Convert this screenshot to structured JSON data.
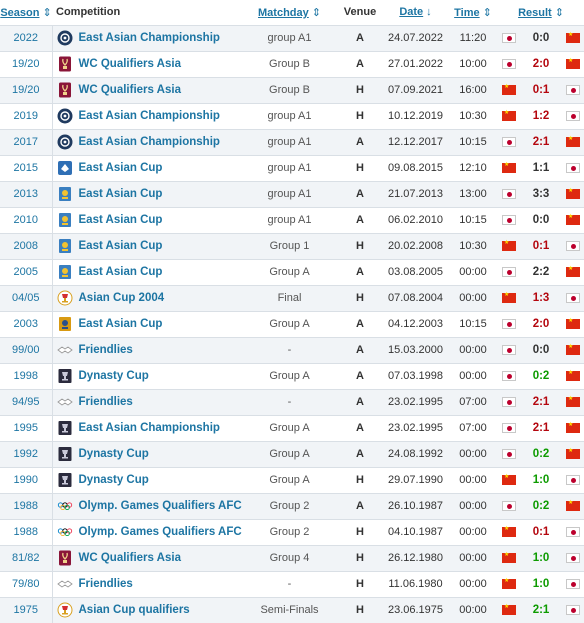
{
  "headers": {
    "season": "Season",
    "competition": "Competition",
    "matchday": "Matchday",
    "venue": "Venue",
    "date": "Date",
    "time": "Time",
    "result": "Result"
  },
  "sort_icons": {
    "season": "⇕",
    "matchday": "⇕",
    "date": "↓",
    "time": "⇕",
    "result": "⇕"
  },
  "colors": {
    "link": "#1d75a3",
    "loss": "#b4060e",
    "win": "#0d9b00",
    "draw": "#333333"
  },
  "rows": [
    {
      "season": "2022",
      "competition": "East Asian Championship",
      "logo": "eaff-logo",
      "matchday": "group A1",
      "venue": "A",
      "date": "24.07.2022",
      "time": "11:20",
      "home_flag": "jpn",
      "away_flag": "chn",
      "score": "0:0",
      "outcome": "draw"
    },
    {
      "season": "19/20",
      "competition": "WC Qualifiers Asia",
      "logo": "world-cup-logo",
      "matchday": "Group B",
      "venue": "A",
      "date": "27.01.2022",
      "time": "10:00",
      "home_flag": "jpn",
      "away_flag": "chn",
      "score": "2:0",
      "outcome": "loss"
    },
    {
      "season": "19/20",
      "competition": "WC Qualifiers Asia",
      "logo": "world-cup-logo",
      "matchday": "Group B",
      "venue": "H",
      "date": "07.09.2021",
      "time": "16:00",
      "home_flag": "chn",
      "away_flag": "jpn",
      "score": "0:1",
      "outcome": "loss"
    },
    {
      "season": "2019",
      "competition": "East Asian Championship",
      "logo": "eaff-logo",
      "matchday": "group A1",
      "venue": "H",
      "date": "10.12.2019",
      "time": "10:30",
      "home_flag": "chn",
      "away_flag": "jpn",
      "score": "1:2",
      "outcome": "loss"
    },
    {
      "season": "2017",
      "competition": "East Asian Championship",
      "logo": "eaff-logo",
      "matchday": "group A1",
      "venue": "A",
      "date": "12.12.2017",
      "time": "10:15",
      "home_flag": "jpn",
      "away_flag": "chn",
      "score": "2:1",
      "outcome": "loss"
    },
    {
      "season": "2015",
      "competition": "East Asian Cup",
      "logo": "eaff-logo-2015",
      "matchday": "group A1",
      "venue": "H",
      "date": "09.08.2015",
      "time": "12:10",
      "home_flag": "chn",
      "away_flag": "jpn",
      "score": "1:1",
      "outcome": "draw"
    },
    {
      "season": "2013",
      "competition": "East Asian Cup",
      "logo": "eaff-cup-logo",
      "matchday": "group A1",
      "venue": "A",
      "date": "21.07.2013",
      "time": "13:00",
      "home_flag": "jpn",
      "away_flag": "chn",
      "score": "3:3",
      "outcome": "draw"
    },
    {
      "season": "2010",
      "competition": "East Asian Cup",
      "logo": "eaff-cup-logo",
      "matchday": "group A1",
      "venue": "A",
      "date": "06.02.2010",
      "time": "10:15",
      "home_flag": "jpn",
      "away_flag": "chn",
      "score": "0:0",
      "outcome": "draw"
    },
    {
      "season": "2008",
      "competition": "East Asian Cup",
      "logo": "eaff-cup-logo",
      "matchday": "Group 1",
      "venue": "H",
      "date": "20.02.2008",
      "time": "10:30",
      "home_flag": "chn",
      "away_flag": "jpn",
      "score": "0:1",
      "outcome": "loss"
    },
    {
      "season": "2005",
      "competition": "East Asian Cup",
      "logo": "eaff-cup-logo",
      "matchday": "Group A",
      "venue": "A",
      "date": "03.08.2005",
      "time": "00:00",
      "home_flag": "jpn",
      "away_flag": "chn",
      "score": "2:2",
      "outcome": "draw"
    },
    {
      "season": "04/05",
      "competition": "Asian Cup 2004",
      "logo": "asian-cup-logo",
      "matchday": "Final",
      "venue": "H",
      "date": "07.08.2004",
      "time": "00:00",
      "home_flag": "chn",
      "away_flag": "jpn",
      "score": "1:3",
      "outcome": "loss"
    },
    {
      "season": "2003",
      "competition": "East Asian Cup",
      "logo": "eaff-cup-gold-logo",
      "matchday": "Group A",
      "venue": "A",
      "date": "04.12.2003",
      "time": "10:15",
      "home_flag": "jpn",
      "away_flag": "chn",
      "score": "2:0",
      "outcome": "loss"
    },
    {
      "season": "99/00",
      "competition": "Friendlies",
      "logo": "handshake-logo",
      "matchday": "-",
      "venue": "A",
      "date": "15.03.2000",
      "time": "00:00",
      "home_flag": "jpn",
      "away_flag": "chn",
      "score": "0:0",
      "outcome": "draw"
    },
    {
      "season": "1998",
      "competition": "Dynasty Cup",
      "logo": "dynasty-cup-logo",
      "matchday": "Group A",
      "venue": "A",
      "date": "07.03.1998",
      "time": "00:00",
      "home_flag": "jpn",
      "away_flag": "chn",
      "score": "0:2",
      "outcome": "win"
    },
    {
      "season": "94/95",
      "competition": "Friendlies",
      "logo": "handshake-logo",
      "matchday": "-",
      "venue": "A",
      "date": "23.02.1995",
      "time": "07:00",
      "home_flag": "jpn",
      "away_flag": "chn",
      "score": "2:1",
      "outcome": "loss"
    },
    {
      "season": "1995",
      "competition": "East Asian Championship",
      "logo": "dynasty-cup-logo",
      "matchday": "Group A",
      "venue": "A",
      "date": "23.02.1995",
      "time": "07:00",
      "home_flag": "jpn",
      "away_flag": "chn",
      "score": "2:1",
      "outcome": "loss"
    },
    {
      "season": "1992",
      "competition": "Dynasty Cup",
      "logo": "dynasty-cup-logo",
      "matchday": "Group A",
      "venue": "A",
      "date": "24.08.1992",
      "time": "00:00",
      "home_flag": "jpn",
      "away_flag": "chn",
      "score": "0:2",
      "outcome": "win"
    },
    {
      "season": "1990",
      "competition": "Dynasty Cup",
      "logo": "dynasty-cup-logo",
      "matchday": "Group A",
      "venue": "H",
      "date": "29.07.1990",
      "time": "00:00",
      "home_flag": "chn",
      "away_flag": "jpn",
      "score": "1:0",
      "outcome": "win"
    },
    {
      "season": "1988",
      "competition": "Olymp. Games Qualifiers AFC",
      "logo": "olympic-rings-logo",
      "matchday": "Group 2",
      "venue": "A",
      "date": "26.10.1987",
      "time": "00:00",
      "home_flag": "jpn",
      "away_flag": "chn",
      "score": "0:2",
      "outcome": "win"
    },
    {
      "season": "1988",
      "competition": "Olymp. Games Qualifiers AFC",
      "logo": "olympic-rings-logo",
      "matchday": "Group 2",
      "venue": "H",
      "date": "04.10.1987",
      "time": "00:00",
      "home_flag": "chn",
      "away_flag": "jpn",
      "score": "0:1",
      "outcome": "loss"
    },
    {
      "season": "81/82",
      "competition": "WC Qualifiers Asia",
      "logo": "world-cup-logo",
      "matchday": "Group 4",
      "venue": "H",
      "date": "26.12.1980",
      "time": "00:00",
      "home_flag": "chn",
      "away_flag": "jpn",
      "score": "1:0",
      "outcome": "win"
    },
    {
      "season": "79/80",
      "competition": "Friendlies",
      "logo": "handshake-logo",
      "matchday": "-",
      "venue": "H",
      "date": "11.06.1980",
      "time": "00:00",
      "home_flag": "chn",
      "away_flag": "jpn",
      "score": "1:0",
      "outcome": "win"
    },
    {
      "season": "1975",
      "competition": "Asian Cup qualifiers",
      "logo": "asian-cup-logo",
      "matchday": "Semi-Finals",
      "venue": "H",
      "date": "23.06.1975",
      "time": "00:00",
      "home_flag": "chn",
      "away_flag": "jpn",
      "score": "2:1",
      "outcome": "win"
    }
  ]
}
